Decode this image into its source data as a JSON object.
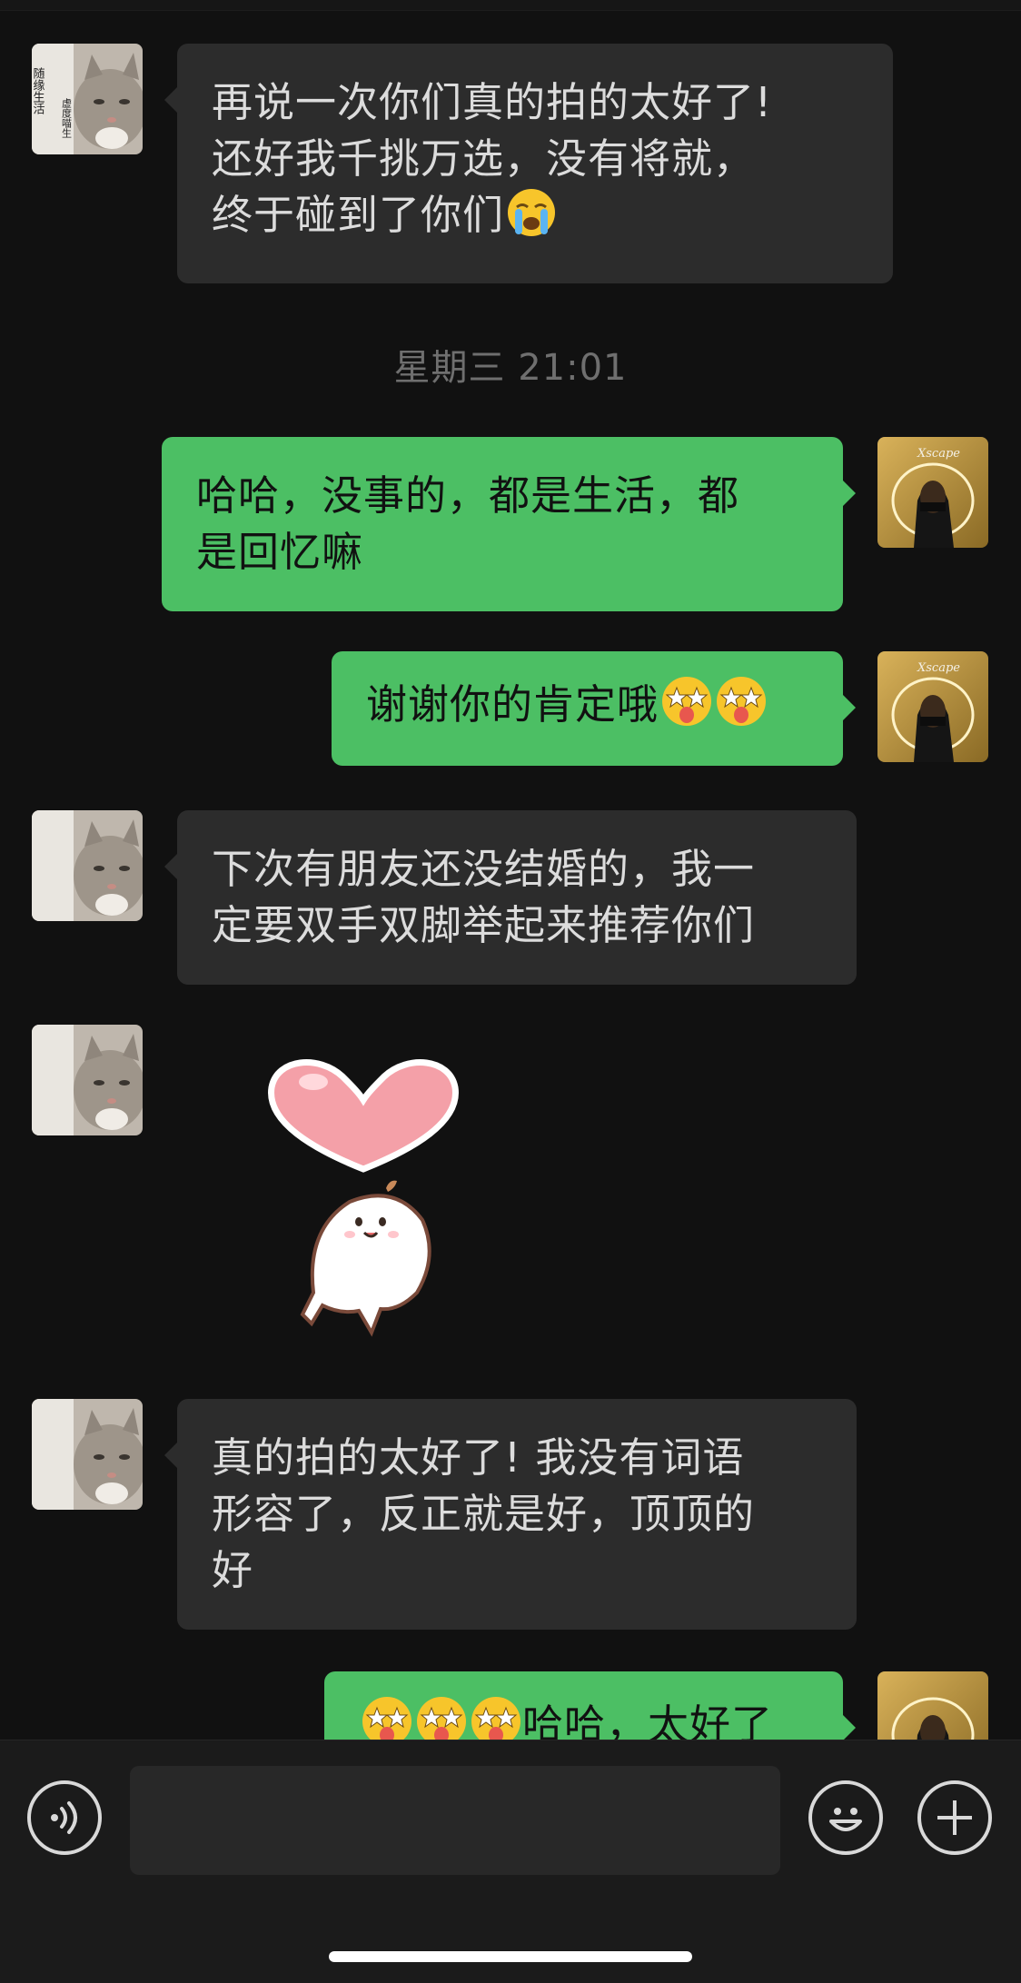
{
  "chat": {
    "timestamp": "星期三 21:01",
    "messages": [
      {
        "side": "in",
        "lines": [
          "再说一次你们真的拍的太好了!",
          "还好我千挑万选，没有将就，",
          "终于碰到了你们"
        ],
        "trailing_emoji": "crying-face"
      },
      {
        "side": "out",
        "lines": [
          "哈哈，没事的，都是生活，都",
          "是回忆嘛"
        ]
      },
      {
        "side": "out",
        "lines": [
          "谢谢你的肯定哦"
        ],
        "trailing_emoji": "starstruck-tongue x2"
      },
      {
        "side": "in",
        "lines": [
          "下次有朋友还没结婚的，我一",
          "定要双手双脚举起来推荐你们"
        ]
      },
      {
        "side": "in",
        "type": "sticker",
        "sticker": "heart-mochi"
      },
      {
        "side": "in",
        "lines": [
          "真的拍的太好了! 我没有词语",
          "形容了，反正就是好，顶顶的",
          "好"
        ]
      },
      {
        "side": "out",
        "lines": [
          "哈哈，太好了"
        ],
        "leading_emoji": "starstruck-tongue x3"
      }
    ]
  },
  "contact_avatar_text": [
    "随缘生活",
    "虚度喵生"
  ],
  "self_avatar_text": "Xscape",
  "input_bar": {
    "voice_icon": "voice-icon",
    "emoji_icon": "emoji-icon",
    "plus_icon": "plus-icon",
    "message_value": ""
  },
  "colors": {
    "background": "#111111",
    "incoming_bubble": "#2c2c2c",
    "outgoing_bubble": "#4cbf64",
    "timestamp": "#6f6f6f"
  }
}
